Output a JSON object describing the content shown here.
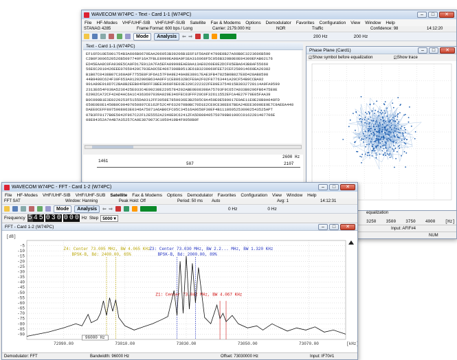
{
  "back_window": {
    "title": "WAVECOM W74PC - Text - Card 1-1 (W74PC)",
    "menu": [
      "File",
      "HF-Modes",
      "VHF/UHF-SIB",
      "VHF/UHF-SUB",
      "Satellite",
      "Fax & Modems",
      "Options",
      "Demodulator",
      "Favorites",
      "Configuration",
      "View",
      "Window",
      "Help"
    ],
    "info": {
      "mode": "STANAG 4285",
      "frame_format": "Frame Format: 600 bps / Long",
      "carrier": "Carrier: 2179.000 Hz",
      "nor": "NOR",
      "traffic": "Traffic",
      "confidence": "Confidence: 98",
      "time": "14:12:20"
    },
    "toolbar": {
      "mode": "Mode",
      "analysis": "Analysis",
      "hz1": "200 Hz",
      "hz2": "200 Hz"
    },
    "text_window_title": "Text - Card 1-1 (W74PC)",
    "hex_lines": [
      "EF16FD10E5001754B3A606B0679EAA206053B39206B1E6F1F50A6F4790E0B27A60B8C3223606B590",
      "C2B0F3006520526B5097740F16A7FBLE8999EA98A9FSEA316068F5C056B320B0E0E04300EFAB02176",
      "ED45EAA8C0FA930E5CA0FD17E912A7FA5EFA09998EAE8AA13AE0260E0E2DCF05EBA643B8AF55660",
      "56E6C2010426EEE07650420C703EA0C5E4067308B0513E61B3239060FEE72CEF258914660EA20382",
      "B1B07C0438B07C360A0F7755E8F3F6A157F9A9E240A8E38017EAE3FB47825B0B827E8D428AB8598",
      "44B9480C624F30F653A01202006B634A0FF1CE80632BCFE0A2F02F87763441A20CF54B9CCBA92",
      "901A80E918D7C2BA8B2EEB04FB6FF3BEE3068F6E03E320C222322FE89E3754015B3832728114A9FA9590",
      "2313E654F039A5236425E033C4E09238E2205784202ABE0E08398A75703F9C657A033B9296FB6475E0E",
      "62902CA72CF42AD4AC6A1C4363607039A029E346FEC03FFF20C0F32611552EFCA4E27F79E05FAA39",
      "B0C098B1E3E0220253F5155DA0312FF3058E7850036E3B2595C9A450E0E580017E0AE11E0E28B9A648FD",
      "650E0E0E1450B0C00407050807CE162F52C4F632070B0BC70D1E2CE0CE30EE07BEA24EEE3600EE9E7C9AEEA448",
      "DAEE0CEFF8075908063E0346A75871A6AB0CFC05C34516A0658F30EF4B11186052530002543525APT",
      "07B3FF0177B0E5042F967C22F12E5552A2340E0C6241ZFA5D808405750799B0100CC0162281407706E",
      "08E84352A7A4B7A35257CA0E3870073C1050419B4F9050B0F"
    ],
    "ruler": {
      "left": "1461",
      "mid": "507",
      "right": "2107",
      "top_right": "2600 Hz"
    }
  },
  "phase_plane": {
    "title": "Phase Plane (Card1)",
    "option1": "Show symbol before equalization",
    "option2": "Show trace",
    "footer": "equalization",
    "bottom_axis": [
      "3250",
      "3500",
      "3750",
      "4000",
      "[Hz]"
    ],
    "input_label": "Input: AFIF#4",
    "num_label": "NUM"
  },
  "front_window": {
    "title": "WAVECOM W74PC - FFT - Card 1-2 (W74PC)",
    "menu": [
      "File",
      "HF-Modes",
      "VHF/UHF-SIB",
      "VHF/UHF-SUB",
      "Satellite",
      "Fax & Modems",
      "Options",
      "Demodulator",
      "Favorites",
      "Configuration",
      "View",
      "Window",
      "Help"
    ],
    "menu_selected": "Satellite",
    "info": {
      "mode": "FFT SAT",
      "window": "Window: Hanning",
      "peak_hold": "Peak Hold: Off",
      "period": "Period: 50 ms",
      "auto": "Auto",
      "avg": "Avg: 1",
      "time": "14:12:31"
    },
    "toolbar": {
      "mode": "Mode",
      "analysis": "Analysis",
      "hz1": "0 Hz",
      "hz2": "0 Hz"
    },
    "frequency_label": "Frequency",
    "frequency_value": [
      "5",
      "4",
      "5",
      "0",
      "3",
      "0",
      "0",
      "0",
      "0"
    ],
    "freq_unit": "Hz",
    "step_label": "Step",
    "step_value": "5000",
    "fft_window_title": "FFT - Card 1-2 (W74PC)",
    "status": {
      "demod": "Demodulator: FFT",
      "bandwidth": "Bandwidth: 96000 Hz",
      "offset": "Offset: 73030000 Hz",
      "input": "Input: IF70#1"
    }
  },
  "chart_data": {
    "type": "line",
    "ylabel": "[dB]",
    "xlabel": "[kHz]",
    "ylim": [
      -95,
      0
    ],
    "y_ticks": [
      -5,
      -10,
      -15,
      -20,
      -25,
      -30,
      -35,
      -40,
      -45,
      -50,
      -55,
      -60,
      -65,
      -70,
      -75,
      -80,
      -85,
      -90
    ],
    "xlim": [
      72978,
      73082
    ],
    "x_ticks": [
      72990.0,
      73010.0,
      73030.0,
      73050.0,
      73070.0
    ],
    "x_tick_labels": [
      "72990.00",
      "73010.00",
      "73030.00",
      "73050.00",
      "73070.00"
    ],
    "annotations": [
      {
        "text": "Z4: Center 73.005 MHz, BW 4.065 KHz",
        "text2": "BPSK-B, Bd: 2400.00, 65%",
        "color": "#b8a400"
      },
      {
        "text": "Z3: Center 73.030 MHz, BW 2.2... MHz, BW 1.320 KHz",
        "text2": "BPSK-B, Bd: 2000.00, 89%",
        "color": "#2030c0"
      },
      {
        "text": "Z1: Center 73.042 MHz, BW 4.067 KHz",
        "color": "#d01010"
      }
    ],
    "bandwidth_label": "96000 Hz",
    "series": [
      {
        "values": [
          [
            72978,
            -92
          ],
          [
            72985,
            -88
          ],
          [
            72990,
            -84
          ],
          [
            72994,
            -80
          ],
          [
            72996,
            -82
          ],
          [
            72998,
            -71
          ],
          [
            72999,
            -79
          ],
          [
            73001,
            -76
          ],
          [
            73002,
            -70
          ],
          [
            73003,
            -58
          ],
          [
            73004,
            -72
          ],
          [
            73005,
            -55
          ],
          [
            73006,
            -68
          ],
          [
            73007,
            -57
          ],
          [
            73008,
            -74
          ],
          [
            73010,
            -82
          ],
          [
            73013,
            -86
          ],
          [
            73016,
            -83
          ],
          [
            73019,
            -80
          ],
          [
            73022,
            -76
          ],
          [
            73024,
            -73
          ],
          [
            73026,
            -48
          ],
          [
            73027,
            -72
          ],
          [
            73028,
            -20
          ],
          [
            73029,
            -70
          ],
          [
            73030,
            -15
          ],
          [
            73031,
            -66
          ],
          [
            73032,
            -22
          ],
          [
            73033,
            -60
          ],
          [
            73034,
            -26
          ],
          [
            73036,
            -74
          ],
          [
            73038,
            -80
          ],
          [
            73040,
            -62
          ],
          [
            73041,
            -75
          ],
          [
            73042,
            -70
          ],
          [
            73043,
            -78
          ],
          [
            73045,
            -72
          ],
          [
            73047,
            -80
          ],
          [
            73050,
            -84
          ],
          [
            73053,
            -82
          ],
          [
            73055,
            -86
          ],
          [
            73058,
            -80
          ],
          [
            73060,
            -83
          ],
          [
            73063,
            -87
          ],
          [
            73066,
            -84
          ],
          [
            73069,
            -86
          ],
          [
            73072,
            -83
          ],
          [
            73075,
            -88
          ],
          [
            73078,
            -86
          ],
          [
            73082,
            -90
          ]
        ]
      }
    ]
  }
}
